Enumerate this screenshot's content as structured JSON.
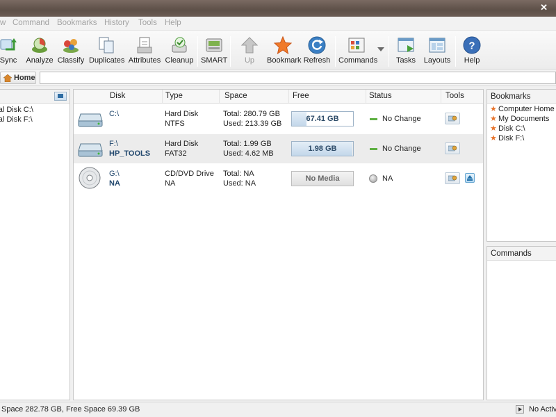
{
  "window": {
    "close_glyph": "✕"
  },
  "menu": [
    "w",
    "Command",
    "Bookmarks",
    "History",
    "Tools",
    "Help"
  ],
  "toolbar": {
    "buttons": [
      {
        "label": "Sync",
        "icon": "sync-icon"
      },
      {
        "label": "Analyze",
        "icon": "analyze-icon"
      },
      {
        "label": "Classify",
        "icon": "classify-icon"
      },
      {
        "label": "Duplicates",
        "icon": "duplicates-icon"
      },
      {
        "label": "Attributes",
        "icon": "attributes-icon"
      },
      {
        "label": "Cleanup",
        "icon": "cleanup-icon"
      },
      {
        "label": "SMART",
        "icon": "smart-icon"
      },
      {
        "label": "Up",
        "icon": "up-arrow-icon",
        "disabled": true
      },
      {
        "label": "Bookmark",
        "icon": "star-icon"
      },
      {
        "label": "Refresh",
        "icon": "refresh-icon"
      },
      {
        "label": "Commands",
        "icon": "commands-icon"
      },
      {
        "label": "Tasks",
        "icon": "tasks-icon"
      },
      {
        "label": "Layouts",
        "icon": "layouts-icon"
      },
      {
        "label": "Help",
        "icon": "help-icon"
      }
    ]
  },
  "address": {
    "home_label": "Home",
    "value": ""
  },
  "left_tree": [
    "Local Disk C:\\",
    "Local Disk F:\\"
  ],
  "table": {
    "headers": [
      "Disk",
      "Type",
      "Space",
      "Free",
      "Status",
      "Tools"
    ],
    "rows": [
      {
        "disk": "C:\\",
        "name": "",
        "type": "Hard Disk",
        "fs": "NTFS",
        "total": "Total: 280.79 GB",
        "used": "Used: 213.39 GB",
        "free": "67.41 GB",
        "free_fraction": 0.24,
        "status": "No Change",
        "icon": "hard-disk-icon"
      },
      {
        "disk": "F:\\",
        "name": "HP_TOOLS",
        "type": "Hard Disk",
        "fs": "FAT32",
        "total": "Total: 1.99 GB",
        "used": "Used: 4.62 MB",
        "free": "1.98 GB",
        "free_fraction": 0.99,
        "status": "No Change",
        "icon": "hard-disk-icon"
      },
      {
        "disk": "G:\\",
        "name": "NA",
        "type": "CD/DVD Drive",
        "fs": "NA",
        "total": "Total: NA",
        "used": "Used: NA",
        "free": "No Media",
        "free_fraction": 0,
        "status": "NA",
        "icon": "cd-dvd-icon"
      }
    ]
  },
  "bookmarks": {
    "title": "Bookmarks",
    "items": [
      "Computer Home",
      "My Documents",
      "Disk C:\\",
      "Disk F:\\"
    ]
  },
  "commands": {
    "title": "Commands"
  },
  "statusbar": {
    "text": "Space 282.78 GB, Free Space 69.39 GB",
    "right_text": "No Activity"
  },
  "colors": {
    "accent": "#2c4a67",
    "status_ok": "#5fb043",
    "star": "#e8742c"
  }
}
